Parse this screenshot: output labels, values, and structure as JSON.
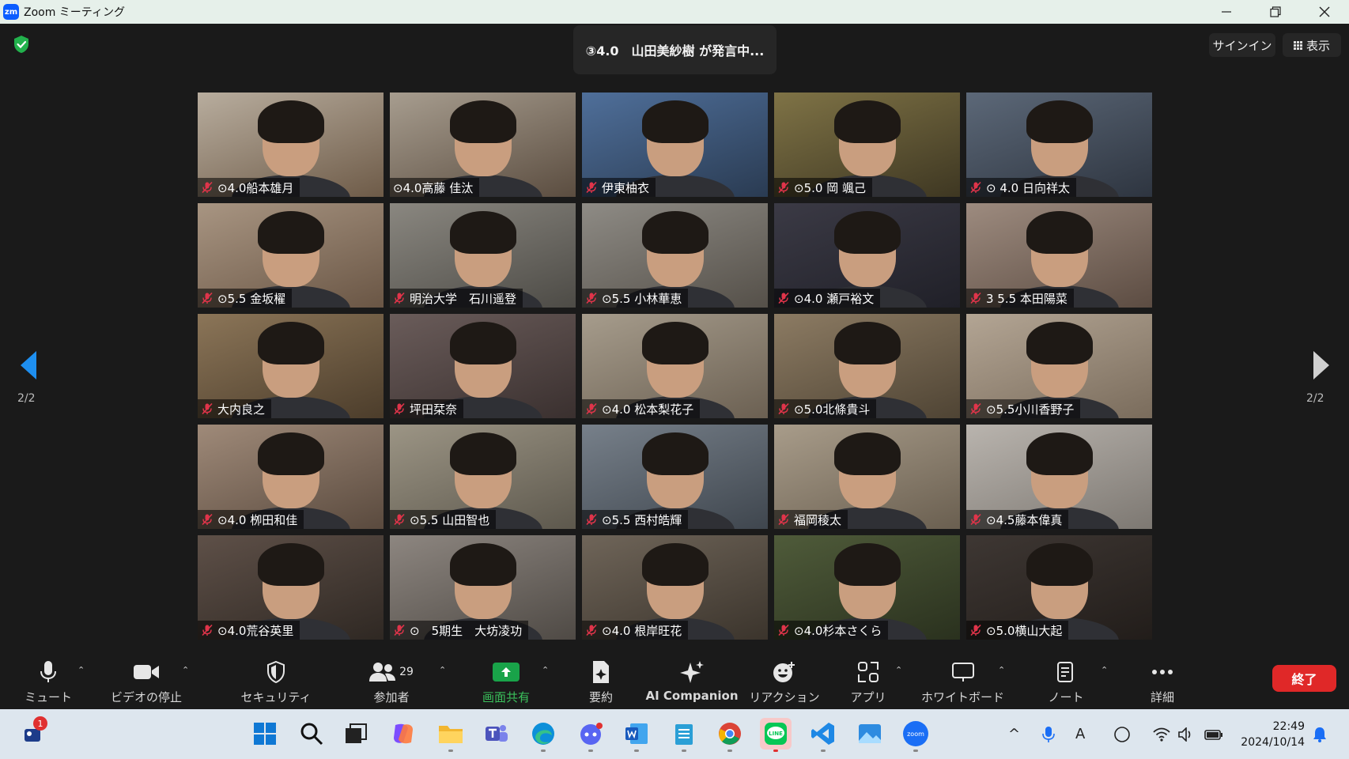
{
  "window": {
    "logo": "zm",
    "title": "Zoom ミーティング",
    "controls": [
      "minimize-icon",
      "restore-icon",
      "close-icon"
    ]
  },
  "meeting": {
    "speaker_status": "③4.0　山田美紗樹 が発言中...",
    "signin_label": "サインイン",
    "view_label": "表示",
    "page_indicator_left": "2/2",
    "page_indicator_right": "2/2"
  },
  "participants": [
    {
      "name": "⊙4.0船本雄月",
      "muted": true
    },
    {
      "name": "⊙4.0高藤 佳汰",
      "muted": false
    },
    {
      "name": "伊東柚衣",
      "muted": true
    },
    {
      "name": "⊙5.0 岡 颯己",
      "muted": true
    },
    {
      "name": "⊙ 4.0 日向祥太",
      "muted": true
    },
    {
      "name": "⊙5.5 金坂櫂",
      "muted": true
    },
    {
      "name": "明治大学　石川遥登",
      "muted": true
    },
    {
      "name": "⊙5.5 小林華恵",
      "muted": true
    },
    {
      "name": "⊙4.0 瀬戸裕文",
      "muted": true
    },
    {
      "name": "3 5.5 本田陽菜",
      "muted": true
    },
    {
      "name": "大内良之",
      "muted": true
    },
    {
      "name": "坪田栞奈",
      "muted": true
    },
    {
      "name": "⊙4.0 松本梨花子",
      "muted": true
    },
    {
      "name": "⊙5.0北條貴斗",
      "muted": true
    },
    {
      "name": "⊙5.5小川香野子",
      "muted": true
    },
    {
      "name": "⊙4.0 栁田和佳",
      "muted": true
    },
    {
      "name": "⊙5.5 山田智也",
      "muted": true
    },
    {
      "name": "⊙5.5 西村皓輝",
      "muted": true
    },
    {
      "name": "福岡稜太",
      "muted": true
    },
    {
      "name": "⊙4.5藤本偉真",
      "muted": true
    },
    {
      "name": "⊙4.0荒谷英里",
      "muted": true
    },
    {
      "name": "⊙　5期生　大坊凌功",
      "muted": true
    },
    {
      "name": "⊙4.0 根岸旺花",
      "muted": true
    },
    {
      "name": "⊙4.0杉本さくら",
      "muted": true
    },
    {
      "name": "⊙5.0横山大起",
      "muted": true
    }
  ],
  "toolbar": {
    "mute": "ミュート",
    "video": "ビデオの停止",
    "security": "セキュリティ",
    "participants": "参加者",
    "participant_count": "29",
    "share": "画面共有",
    "summary": "要約",
    "ai": "AI Companion",
    "reactions": "リアクション",
    "apps": "アプリ",
    "whiteboard": "ホワイトボード",
    "notes": "ノート",
    "more": "詳細",
    "end": "終了"
  },
  "taskbar": {
    "notification_count": "1",
    "zoom_label": "zoom",
    "line_label": "LINE",
    "time": "22:49",
    "date": "2024/10/14"
  },
  "colors": {
    "background": "#1a1a1a",
    "share_green": "#19a349",
    "end_red": "#e02828",
    "mute_red": "#e0344a",
    "taskbar": "#dde6ee",
    "titlebar": "#e6f0ea"
  }
}
